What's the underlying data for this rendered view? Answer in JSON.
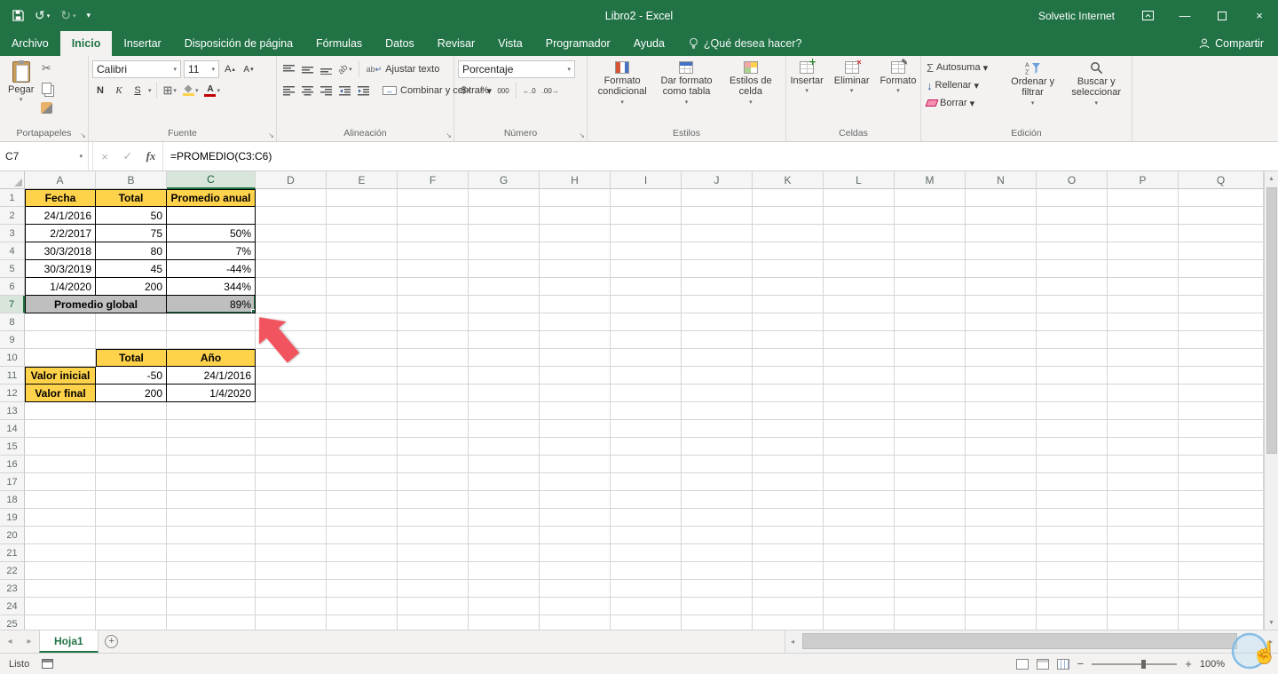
{
  "colors": {
    "accent": "#217346",
    "cell_yellow": "#ffd24b",
    "cell_gray": "#bfbfbf",
    "arrow_red": "#f2545f"
  },
  "titlebar": {
    "title": "Libro2  -  Excel",
    "user": "Solvetic Internet"
  },
  "ribbon_tabs": [
    "Archivo",
    "Inicio",
    "Insertar",
    "Disposición de página",
    "Fórmulas",
    "Datos",
    "Revisar",
    "Vista",
    "Programador",
    "Ayuda"
  ],
  "tell_me": "¿Qué desea hacer?",
  "share_label": "Compartir",
  "ribbon": {
    "paste_label": "Pegar",
    "clipboard_group": "Portapapeles",
    "font_name": "Calibri",
    "font_size": "11",
    "bold": "N",
    "italic": "K",
    "underline": "S",
    "font_group": "Fuente",
    "wrap_text": "Ajustar texto",
    "merge_center": "Combinar y centrar",
    "alignment_group": "Alineación",
    "number_format": "Porcentaje",
    "currency": "$",
    "percent_btn": "%",
    "thousands": "000",
    "number_group": "Número",
    "conditional_format": "Formato condicional",
    "format_table": "Dar formato como tabla",
    "cell_styles": "Estilos de celda",
    "styles_group": "Estilos",
    "insert": "Insertar",
    "delete": "Eliminar",
    "format": "Formato",
    "cells_group": "Celdas",
    "autosum": "Autosuma",
    "fill": "Rellenar",
    "clear": "Borrar",
    "sort_filter": "Ordenar y filtrar",
    "find_select": "Buscar y seleccionar",
    "editing_group": "Edición"
  },
  "formula_bar": {
    "name_box": "C7",
    "fx": "fx",
    "formula": "=PROMEDIO(C3:C6)"
  },
  "grid": {
    "columns": [
      "A",
      "B",
      "C",
      "D",
      "E",
      "F",
      "G",
      "H",
      "I",
      "J",
      "K",
      "L",
      "M",
      "N",
      "O",
      "P",
      "Q"
    ],
    "row_count": 25,
    "selected_column": "C",
    "selected_row": 7,
    "selected_cell": "C7",
    "cells": [
      {
        "ref": "A1",
        "v": "Fecha",
        "k": "h",
        "e": "lt"
      },
      {
        "ref": "B1",
        "v": "Total",
        "k": "h",
        "e": "t"
      },
      {
        "ref": "C1",
        "v": "Promedio anual",
        "k": "h",
        "e": "t"
      },
      {
        "ref": "A2",
        "v": "24/1/2016",
        "k": "d",
        "e": "l"
      },
      {
        "ref": "B2",
        "v": "50",
        "k": "v"
      },
      {
        "ref": "C2",
        "v": "",
        "k": "v"
      },
      {
        "ref": "A3",
        "v": "2/2/2017",
        "k": "d",
        "e": "l"
      },
      {
        "ref": "B3",
        "v": "75",
        "k": "v"
      },
      {
        "ref": "C3",
        "v": "50%",
        "k": "v"
      },
      {
        "ref": "A4",
        "v": "30/3/2018",
        "k": "d",
        "e": "l"
      },
      {
        "ref": "B4",
        "v": "80",
        "k": "v"
      },
      {
        "ref": "C4",
        "v": "7%",
        "k": "v"
      },
      {
        "ref": "A5",
        "v": "30/3/2019",
        "k": "d",
        "e": "l"
      },
      {
        "ref": "B5",
        "v": "45",
        "k": "v"
      },
      {
        "ref": "C5",
        "v": "-44%",
        "k": "v"
      },
      {
        "ref": "A6",
        "v": "1/4/2020",
        "k": "d",
        "e": "l"
      },
      {
        "ref": "B6",
        "v": "200",
        "k": "v"
      },
      {
        "ref": "C6",
        "v": "344%",
        "k": "v"
      },
      {
        "ref": "A7",
        "v": "Promedio global",
        "k": "gl",
        "e": "l",
        "span": 2
      },
      {
        "ref": "C7",
        "v": "89%",
        "k": "gv",
        "sel": true
      },
      {
        "ref": "B10",
        "v": "Total",
        "k": "h",
        "e": "lt"
      },
      {
        "ref": "C10",
        "v": "Año",
        "k": "h",
        "e": "t"
      },
      {
        "ref": "A11",
        "v": "Valor inicial",
        "k": "h",
        "e": "lt"
      },
      {
        "ref": "B11",
        "v": "-50",
        "k": "v"
      },
      {
        "ref": "C11",
        "v": "24/1/2016",
        "k": "d"
      },
      {
        "ref": "A12",
        "v": "Valor final",
        "k": "h",
        "e": "l"
      },
      {
        "ref": "B12",
        "v": "200",
        "k": "v"
      },
      {
        "ref": "C12",
        "v": "1/4/2020",
        "k": "d"
      }
    ]
  },
  "sheet": {
    "name": "Hoja1"
  },
  "status": {
    "ready": "Listo",
    "zoom": "100%"
  }
}
